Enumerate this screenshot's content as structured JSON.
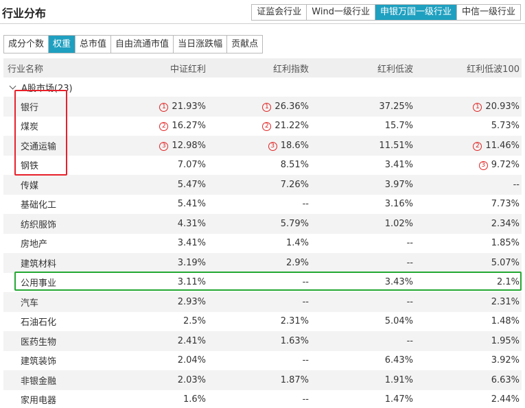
{
  "header": {
    "title": "行业分布",
    "classification_tabs": [
      {
        "label": "证监会行业",
        "active": false
      },
      {
        "label": "Wind一级行业",
        "active": false
      },
      {
        "label": "申银万国一级行业",
        "active": true
      },
      {
        "label": "中信一级行业",
        "active": false
      }
    ]
  },
  "metric_tabs": [
    {
      "label": "成分个数",
      "active": false
    },
    {
      "label": "权重",
      "active": true
    },
    {
      "label": "总市值",
      "active": false
    },
    {
      "label": "自由流通市值",
      "active": false
    },
    {
      "label": "当日涨跌幅",
      "active": false
    },
    {
      "label": "贡献点",
      "active": false
    }
  ],
  "table": {
    "columns": [
      "行业名称",
      "中证红利",
      "红利指数",
      "红利低波",
      "红利低波100"
    ],
    "group_label": "A股市场(23)",
    "rows": [
      {
        "name": "银行",
        "cells": [
          {
            "rank": "1",
            "value": "21.93%"
          },
          {
            "rank": "1",
            "value": "26.36%"
          },
          {
            "rank": "",
            "value": "37.25%"
          },
          {
            "rank": "1",
            "value": "20.93%"
          }
        ]
      },
      {
        "name": "煤炭",
        "cells": [
          {
            "rank": "2",
            "value": "16.27%"
          },
          {
            "rank": "2",
            "value": "21.22%"
          },
          {
            "rank": "",
            "value": "15.7%"
          },
          {
            "rank": "",
            "value": "5.73%"
          }
        ]
      },
      {
        "name": "交通运输",
        "cells": [
          {
            "rank": "3",
            "value": "12.98%"
          },
          {
            "rank": "3",
            "value": "18.6%"
          },
          {
            "rank": "",
            "value": "11.51%"
          },
          {
            "rank": "2",
            "value": "11.46%"
          }
        ]
      },
      {
        "name": "钢铁",
        "cells": [
          {
            "rank": "",
            "value": "7.07%"
          },
          {
            "rank": "",
            "value": "8.51%"
          },
          {
            "rank": "",
            "value": "3.41%"
          },
          {
            "rank": "3",
            "value": "9.72%"
          }
        ]
      },
      {
        "name": "传媒",
        "cells": [
          {
            "rank": "",
            "value": "5.47%"
          },
          {
            "rank": "",
            "value": "7.26%"
          },
          {
            "rank": "",
            "value": "3.97%"
          },
          {
            "rank": "",
            "value": "--"
          }
        ]
      },
      {
        "name": "基础化工",
        "cells": [
          {
            "rank": "",
            "value": "5.41%"
          },
          {
            "rank": "",
            "value": "--"
          },
          {
            "rank": "",
            "value": "3.16%"
          },
          {
            "rank": "",
            "value": "7.73%"
          }
        ]
      },
      {
        "name": "纺织服饰",
        "cells": [
          {
            "rank": "",
            "value": "4.31%"
          },
          {
            "rank": "",
            "value": "5.79%"
          },
          {
            "rank": "",
            "value": "1.02%"
          },
          {
            "rank": "",
            "value": "2.34%"
          }
        ]
      },
      {
        "name": "房地产",
        "cells": [
          {
            "rank": "",
            "value": "3.41%"
          },
          {
            "rank": "",
            "value": "1.4%"
          },
          {
            "rank": "",
            "value": "--"
          },
          {
            "rank": "",
            "value": "1.85%"
          }
        ]
      },
      {
        "name": "建筑材料",
        "cells": [
          {
            "rank": "",
            "value": "3.19%"
          },
          {
            "rank": "",
            "value": "2.9%"
          },
          {
            "rank": "",
            "value": "--"
          },
          {
            "rank": "",
            "value": "5.07%"
          }
        ]
      },
      {
        "name": "公用事业",
        "cells": [
          {
            "rank": "",
            "value": "3.11%"
          },
          {
            "rank": "",
            "value": "--"
          },
          {
            "rank": "",
            "value": "3.43%"
          },
          {
            "rank": "",
            "value": "2.1%"
          }
        ]
      },
      {
        "name": "汽车",
        "cells": [
          {
            "rank": "",
            "value": "2.93%"
          },
          {
            "rank": "",
            "value": "--"
          },
          {
            "rank": "",
            "value": "--"
          },
          {
            "rank": "",
            "value": "2.31%"
          }
        ]
      },
      {
        "name": "石油石化",
        "cells": [
          {
            "rank": "",
            "value": "2.5%"
          },
          {
            "rank": "",
            "value": "2.31%"
          },
          {
            "rank": "",
            "value": "5.04%"
          },
          {
            "rank": "",
            "value": "1.48%"
          }
        ]
      },
      {
        "name": "医药生物",
        "cells": [
          {
            "rank": "",
            "value": "2.41%"
          },
          {
            "rank": "",
            "value": "1.63%"
          },
          {
            "rank": "",
            "value": "--"
          },
          {
            "rank": "",
            "value": "1.95%"
          }
        ]
      },
      {
        "name": "建筑装饰",
        "cells": [
          {
            "rank": "",
            "value": "2.04%"
          },
          {
            "rank": "",
            "value": "--"
          },
          {
            "rank": "",
            "value": "6.43%"
          },
          {
            "rank": "",
            "value": "3.92%"
          }
        ]
      },
      {
        "name": "非银金融",
        "cells": [
          {
            "rank": "",
            "value": "2.03%"
          },
          {
            "rank": "",
            "value": "1.87%"
          },
          {
            "rank": "",
            "value": "1.91%"
          },
          {
            "rank": "",
            "value": "6.63%"
          }
        ]
      },
      {
        "name": "家用电器",
        "cells": [
          {
            "rank": "",
            "value": "1.6%"
          },
          {
            "rank": "",
            "value": "--"
          },
          {
            "rank": "",
            "value": "1.47%"
          },
          {
            "rank": "",
            "value": "2.44%"
          }
        ]
      }
    ]
  },
  "colors": {
    "active_tab": "#1fa0c0",
    "rank_marker": "#e02424",
    "highlight_red": "#e8202a",
    "highlight_green": "#22a832"
  }
}
